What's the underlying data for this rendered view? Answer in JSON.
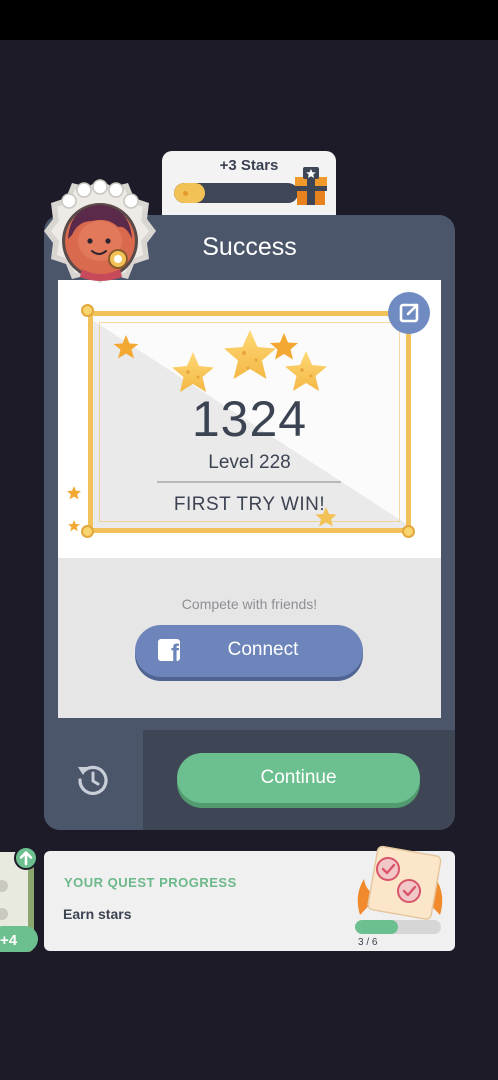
{
  "reward": {
    "title": "+3 Stars",
    "progress": 0.25,
    "icon": "gift-box-icon"
  },
  "card": {
    "title": "Success",
    "score": "1324",
    "level": "Level 228",
    "subtitle": "FIRST TRY WIN!",
    "stars_earned": 3,
    "share_icon": "share-icon"
  },
  "social": {
    "prompt": "Compete with friends!",
    "connect_label": "Connect",
    "icon": "facebook-icon"
  },
  "footer": {
    "retry_icon": "replay-icon",
    "continue_label": "Continue"
  },
  "quest": {
    "title": "YOUR QUEST PROGRESS",
    "description": "Earn stars",
    "count": "3 / 6",
    "progress": 0.5
  },
  "side_tab": {
    "label": "+4",
    "icon": "arrow-up-icon"
  },
  "colors": {
    "background": "#1d1b28",
    "card": "#4c566b",
    "accent_green": "#6cc08f",
    "facebook_blue": "#6d85bb",
    "gold": "#f1c15a"
  }
}
